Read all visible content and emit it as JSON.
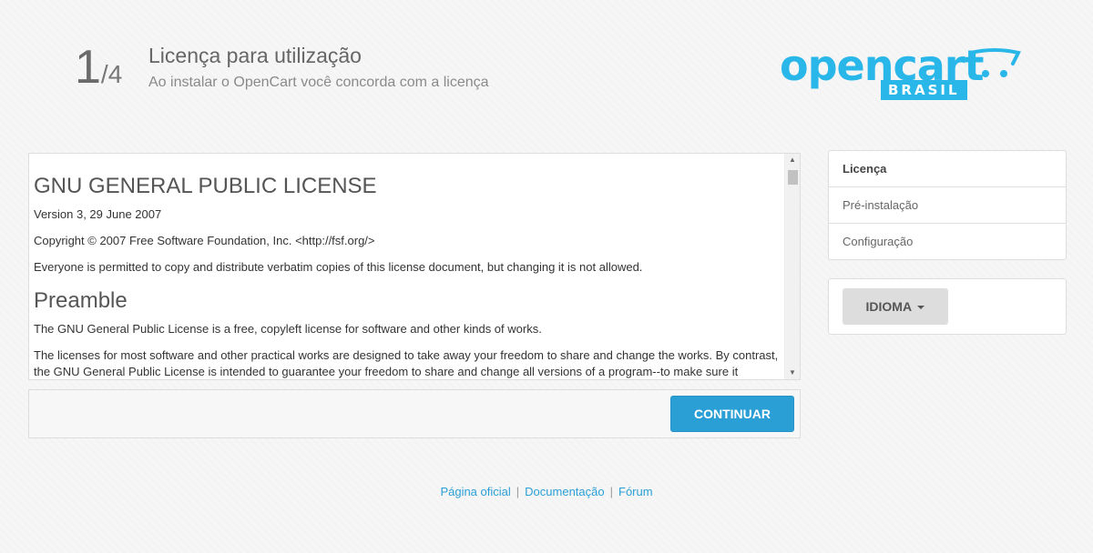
{
  "header": {
    "step_current": "1",
    "step_total": "/4",
    "title": "Licença para utilização",
    "subtitle": "Ao instalar o OpenCart você concorda com a licença"
  },
  "logo": {
    "word": "opencart",
    "sub": "BRASIL"
  },
  "license": {
    "heading": "GNU GENERAL PUBLIC LICENSE",
    "version": "Version 3, 29 June 2007",
    "copyright": "Copyright © 2007 Free Software Foundation, Inc. <http://fsf.org/>",
    "permission": "Everyone is permitted to copy and distribute verbatim copies of this license document, but changing it is not allowed.",
    "preamble_heading": "Preamble",
    "preamble_p1": "The GNU General Public License is a free, copyleft license for software and other kinds of works.",
    "preamble_p2": "The licenses for most software and other practical works are designed to take away your freedom to share and change the works. By contrast, the GNU General Public License is intended to guarantee your freedom to share and change all versions of a program--to make sure it remains free software for all its users."
  },
  "actions": {
    "continue_label": "CONTINUAR"
  },
  "steps": [
    {
      "label": "Licença"
    },
    {
      "label": "Pré-instalação"
    },
    {
      "label": "Configuração"
    }
  ],
  "language": {
    "label": "IDIOMA"
  },
  "footer": {
    "link_official": "Página oficial",
    "link_docs": "Documentação",
    "link_forum": "Fórum",
    "separator": "|"
  },
  "colors": {
    "accent": "#2a9fd6",
    "logo": "#29b6e8"
  }
}
